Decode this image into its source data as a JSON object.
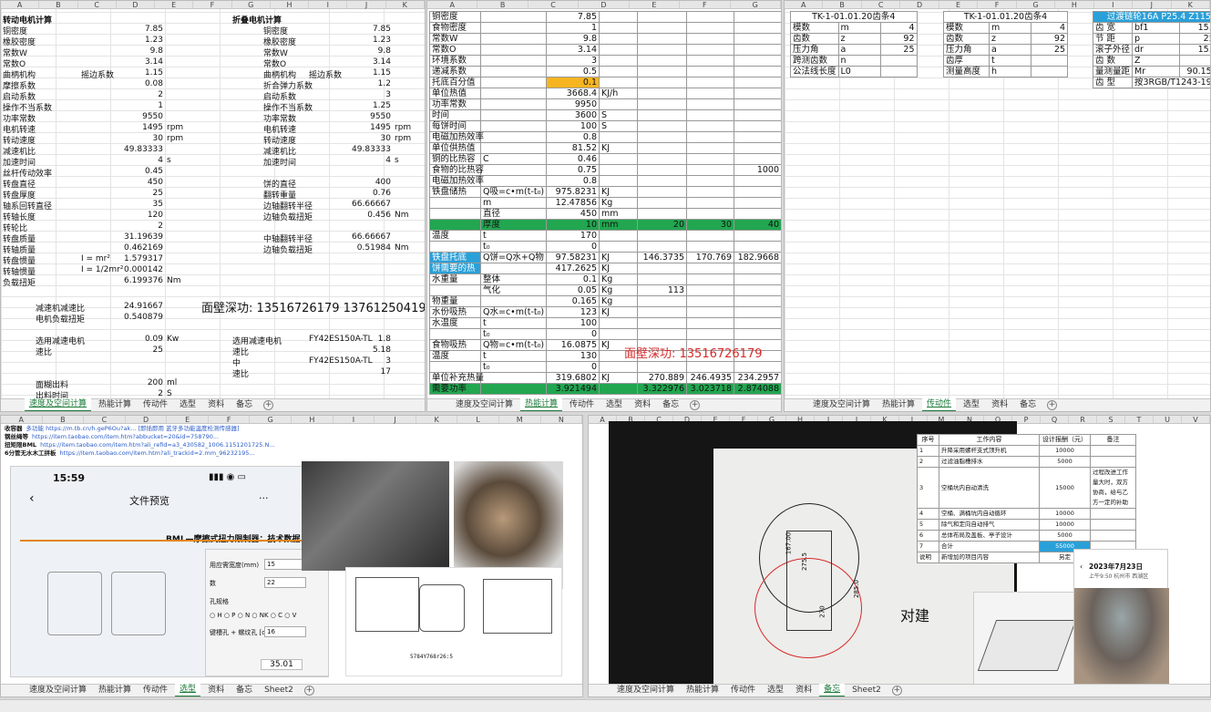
{
  "tabs": {
    "tl": [
      "速度及空间计算",
      "热能计算",
      "传动件",
      "选型",
      "资料",
      "备忘"
    ],
    "tm": [
      "速度及空间计算",
      "热能计算",
      "传动件",
      "选型",
      "资料",
      "备忘"
    ],
    "tr": [
      "速度及空间计算",
      "热能计算",
      "传动件",
      "选型",
      "资料",
      "备忘"
    ],
    "bl": [
      "速度及空间计算",
      "热能计算",
      "传动件",
      "选型",
      "资料",
      "备忘",
      "Sheet2"
    ],
    "br": [
      "速度及空间计算",
      "热能计算",
      "传动件",
      "选型",
      "资料",
      "备忘",
      "Sheet2"
    ]
  },
  "tl": {
    "title_left": "转动电机计算",
    "title_right": "折叠电机计算",
    "left_rows": [
      [
        "铜密度",
        "",
        "7.85",
        ""
      ],
      [
        "橡胶密度",
        "",
        "1.23",
        ""
      ],
      [
        "常数W",
        "",
        "9.8",
        ""
      ],
      [
        "常数O",
        "",
        "3.14",
        ""
      ],
      [
        "曲柄机构",
        "摇边系数",
        "1.15",
        ""
      ],
      [
        "摩擦系数",
        "",
        "0.08",
        ""
      ],
      [
        "启动系数",
        "",
        "2",
        ""
      ],
      [
        "操作不当系数",
        "",
        "1",
        ""
      ],
      [
        "功率常数",
        "",
        "9550",
        ""
      ],
      [
        "电机转速",
        "",
        "1495",
        "rpm"
      ],
      [
        "转动速度",
        "",
        "30",
        "rpm"
      ],
      [
        "减速机比",
        "",
        "49.83333",
        ""
      ],
      [
        "加速时间",
        "",
        "4",
        "s"
      ],
      [
        "丝杆传动效率",
        "",
        "0.45",
        ""
      ],
      [
        "转盘直径",
        "",
        "450",
        ""
      ],
      [
        "转盘厚度",
        "",
        "25",
        ""
      ],
      [
        "轴系回转直径",
        "",
        "35",
        ""
      ],
      [
        "转轴长度",
        "",
        "120",
        ""
      ],
      [
        "转轮比",
        "",
        "2",
        ""
      ],
      [
        "转盘质量",
        "",
        "31.19639",
        ""
      ],
      [
        "转轴质量",
        "",
        "0.462169",
        ""
      ],
      [
        "转盘惯量",
        "I = mr²",
        "1.579317",
        ""
      ],
      [
        "转轴惯量",
        "I = 1/2mr²",
        "0.000142",
        ""
      ],
      [
        "负载扭矩",
        "",
        "6.199376",
        "Nm"
      ]
    ],
    "right_rows": [
      [
        "铜密度",
        "",
        "7.85",
        ""
      ],
      [
        "橡胶密度",
        "",
        "1.23",
        ""
      ],
      [
        "常数W",
        "",
        "9.8",
        ""
      ],
      [
        "常数O",
        "",
        "3.14",
        ""
      ],
      [
        "曲柄机构",
        "摇边系数",
        "1.15",
        ""
      ],
      [
        "折合弹力系数",
        "",
        "1.2",
        ""
      ],
      [
        "启动系数",
        "",
        "3",
        ""
      ],
      [
        "操作不当系数",
        "",
        "1.25",
        ""
      ],
      [
        "功率常数",
        "",
        "9550",
        ""
      ],
      [
        "电机转速",
        "",
        "1495",
        "rpm"
      ],
      [
        "转动速度",
        "",
        "30",
        "rpm"
      ],
      [
        "减速机比",
        "",
        "49.83333",
        ""
      ],
      [
        "加速时间",
        "",
        "4",
        "s"
      ],
      [
        "",
        "",
        "",
        ""
      ],
      [
        "饼的直径",
        "",
        "400",
        ""
      ],
      [
        "翻转重量",
        "",
        "0.76",
        ""
      ],
      [
        "边轴翻转半径",
        "",
        "66.66667",
        ""
      ],
      [
        "边轴负载扭矩",
        "",
        "0.456",
        "Nm"
      ],
      [
        "",
        "",
        "",
        ""
      ],
      [
        "中轴翻转半径",
        "",
        "66.66667",
        ""
      ],
      [
        "边轴负载扭矩",
        "",
        "0.51984",
        "Nm"
      ]
    ],
    "lower_left": [
      [
        "减速机减速比",
        "24.91667",
        ""
      ],
      [
        "电机负载扭矩",
        "0.540879",
        ""
      ],
      [
        "",
        "",
        ""
      ],
      [
        "选用减速电机",
        "0.09",
        "Kw"
      ],
      [
        "速比",
        "25",
        ""
      ]
    ],
    "bottom_left": [
      [
        "面糊出料",
        "200",
        "ml"
      ],
      [
        "出料时间",
        "2",
        "S"
      ]
    ],
    "phone": "面壁深功:  13516726179 13761250419",
    "right_sel": [
      [
        "选用减速电机",
        "FY42ES150A-TL",
        "1.8"
      ],
      [
        "速比",
        "",
        "5.18"
      ],
      [
        "中",
        "FY42ES150A-TL",
        "3"
      ],
      [
        "速比",
        "",
        "17"
      ]
    ]
  },
  "tm": {
    "rows": [
      [
        "铜密度",
        "",
        "7.85",
        ""
      ],
      [
        "食物密度",
        "",
        "1",
        ""
      ],
      [
        "常数W",
        "",
        "9.8",
        ""
      ],
      [
        "常数O",
        "",
        "3.14",
        ""
      ],
      [
        "环境系数",
        "",
        "3",
        ""
      ],
      [
        "递减系数",
        "",
        "0.5",
        ""
      ],
      [
        "托底百分值",
        "",
        "0.1",
        ""
      ],
      [
        "单位热值",
        "",
        "3668.4",
        "KJ/h"
      ],
      [
        "功率常数",
        "",
        "9950",
        ""
      ],
      [
        "时间",
        "",
        "3600",
        "S"
      ],
      [
        "每饼时间",
        "",
        "100",
        "S"
      ],
      [
        "电磁加热效率",
        "",
        "0.8",
        ""
      ],
      [
        "单位供热值",
        "",
        "81.52",
        "KJ"
      ],
      [
        "铜的比热容",
        "C",
        "0.46",
        ""
      ],
      [
        "食物的比热容",
        "",
        "0.75",
        ""
      ],
      [
        "电磁加热效率",
        "",
        "0.8",
        ""
      ],
      [
        "铁盘储热",
        "Q吸=c•m(t-t₀)",
        "975.8231",
        "KJ"
      ],
      [
        "",
        "m",
        "12.47856",
        "Kg"
      ],
      [
        "",
        "直径",
        "450",
        "mm"
      ],
      [
        "",
        "厚度",
        "10",
        "mm"
      ],
      [
        "温度",
        "t",
        "170",
        ""
      ],
      [
        "",
        "t₀",
        "0",
        ""
      ],
      [
        "铁盘托底",
        "Q饼=Q水+Q物",
        "97.58231",
        "KJ"
      ],
      [
        "饼需要的热",
        "",
        "417.2625",
        "KJ"
      ],
      [
        "水重量",
        "整体",
        "0.1",
        "Kg"
      ],
      [
        "",
        "气化",
        "0.05",
        "Kg"
      ],
      [
        "物重量",
        "",
        "0.165",
        "Kg"
      ],
      [
        "水份吸热",
        "Q水=c•m(t-t₀)",
        "123",
        "KJ"
      ],
      [
        "水温度",
        "t",
        "100",
        ""
      ],
      [
        "",
        "t₀",
        "0",
        ""
      ],
      [
        "食物吸热",
        "Q物=c•m(t-t₀)",
        "16.0875",
        "KJ"
      ],
      [
        "温度",
        "t",
        "130",
        ""
      ],
      [
        "",
        "t₀",
        "0",
        ""
      ],
      [
        "单位补充热量",
        "",
        "319.6802",
        "KJ"
      ],
      [
        "需要功率",
        "",
        "3.921494",
        ""
      ]
    ],
    "extra_1000": "1000",
    "thick_row": [
      "20",
      "30",
      "40"
    ],
    "tray_row": [
      "146.3735",
      "170.769",
      "182.9668"
    ],
    "v113": "113",
    "supp_row": [
      "270.889",
      "246.4935",
      "234.2957"
    ],
    "power_row": [
      "3.322976",
      "3.023718",
      "2.874088"
    ],
    "phone": "面壁深功:  13516726179"
  },
  "tr": {
    "t1_title": "TK-1-01.01.20齿条4",
    "t1": [
      [
        "模数",
        "m",
        "4"
      ],
      [
        "齿数",
        "z",
        "92"
      ],
      [
        "压力角",
        "a",
        "25"
      ],
      [
        "跨测齿数",
        "n",
        ""
      ],
      [
        "公法线长度",
        "L0",
        ""
      ]
    ],
    "t2_title": "TK-1-01.01.20齿条4",
    "t2": [
      [
        "模数",
        "m",
        "4"
      ],
      [
        "齿数",
        "z",
        "92"
      ],
      [
        "压力角",
        "a",
        "25"
      ],
      [
        "齿厚",
        "t",
        ""
      ],
      [
        "测量高度",
        "h",
        ""
      ]
    ],
    "t3_title": "过渡链轮16A P25.4 Z115",
    "t3": [
      [
        "齿 宽",
        "bf1",
        "15.75"
      ],
      [
        "节 距",
        "p",
        "25.4"
      ],
      [
        "滚子外径",
        "dr",
        "15.88"
      ],
      [
        "齿 数",
        "Z",
        "11"
      ],
      [
        "量测量距",
        "Mr",
        "90.1564"
      ]
    ],
    "t3_type": [
      "齿 型",
      "按3RGB/T1243-1997"
    ]
  },
  "bl": {
    "links": [
      [
        "收容器",
        "多功能 https://m.tb.cn/h.geP6Ou?ak...  [即插即用 蓝牙多功能温度检测传感器]"
      ],
      [
        "钢丝绳等",
        "https://item.taobao.com/item.htm?abbucket=20&id=758790..."
      ],
      [
        "扭矩限BML",
        "https://item.taobao.com/item.htm?ali_refid=a3_430582_1006.1151201725.N..."
      ],
      [
        "6分管无水木工拼板",
        "https://item.taobao.com/item.htm?ali_trackid=2.mm_96232195..."
      ]
    ],
    "phone_time": "15:59",
    "phone_title": "文件预览",
    "doc_title": "BML—摩擦式扭力限制器：技术数据",
    "form_rows": [
      [
        "用应需宽度(mm)",
        "15"
      ],
      [
        "数",
        "22"
      ],
      [
        "孔规格",
        ""
      ],
      [
        "键槽孔 + 螺纹孔 [d]:",
        "16"
      ]
    ],
    "radio": [
      "H",
      "P",
      "N",
      "NK",
      "C",
      "V"
    ],
    "form_value": "35.01",
    "drawing_note": "5784Y768r26:5"
  },
  "br": {
    "table_header": [
      "序号",
      "工作内容",
      "设计报酬（元）",
      "备注"
    ],
    "table_rows": [
      [
        "1",
        "升降采用螺杆支式顶升机",
        "10000",
        ""
      ],
      [
        "2",
        "过滤油脂槽排水",
        "5000",
        ""
      ],
      [
        "3",
        "空桶坑内自动清洗",
        "15000",
        "过程改进工作量大时，双方协商，给与乙方一定的补助"
      ],
      [
        "4",
        "空桶、满桶坑内自动循环",
        "10000",
        ""
      ],
      [
        "5",
        "除气和定向自动排气",
        "10000",
        ""
      ],
      [
        "6",
        "总体布局及盖板、亭子设计",
        "5000",
        ""
      ],
      [
        "7",
        "合计",
        "55000",
        ""
      ],
      [
        "说明",
        "新增加的项目内容",
        "另定",
        ""
      ]
    ],
    "sketch_label": "对建",
    "dims": [
      "167.00",
      "275.5",
      "270",
      "285.0"
    ],
    "photo_date": "2023年7月23日",
    "photo_sub": "上午9:50 杭州市 西湖区"
  }
}
